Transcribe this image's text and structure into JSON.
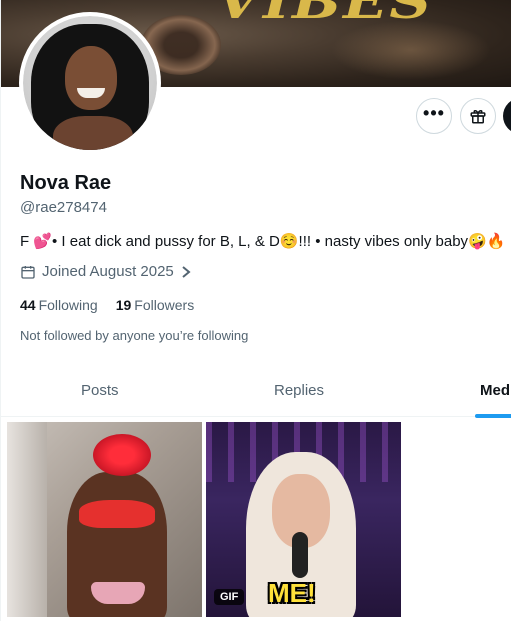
{
  "banner": {
    "title_text": "VIBES"
  },
  "profile": {
    "name": "Nova Rae",
    "handle": "@rae278474",
    "bio": "F 💕• I eat dick and pussy for B, L, & D☺️!!! • nasty vibes only baby🤪🔥",
    "joined": "Joined August 2025",
    "following_count": "44",
    "following_label": "Following",
    "followers_count": "19",
    "followers_label": "Followers",
    "not_followed_text": "Not followed by anyone you’re following"
  },
  "actions": {
    "more_icon": "more-horizontal-icon",
    "gift_icon": "gift-icon",
    "more_glyph": "•••"
  },
  "tabs": [
    {
      "label": "Posts",
      "active": false
    },
    {
      "label": "Replies",
      "active": false
    },
    {
      "label": "Med",
      "active": true
    }
  ],
  "media": [
    {
      "type": "image"
    },
    {
      "type": "gif",
      "badge": "GIF",
      "caption": "ME!"
    }
  ],
  "colors": {
    "accent": "#1d9bf0",
    "text_primary": "#0f1419",
    "text_secondary": "#536471"
  }
}
